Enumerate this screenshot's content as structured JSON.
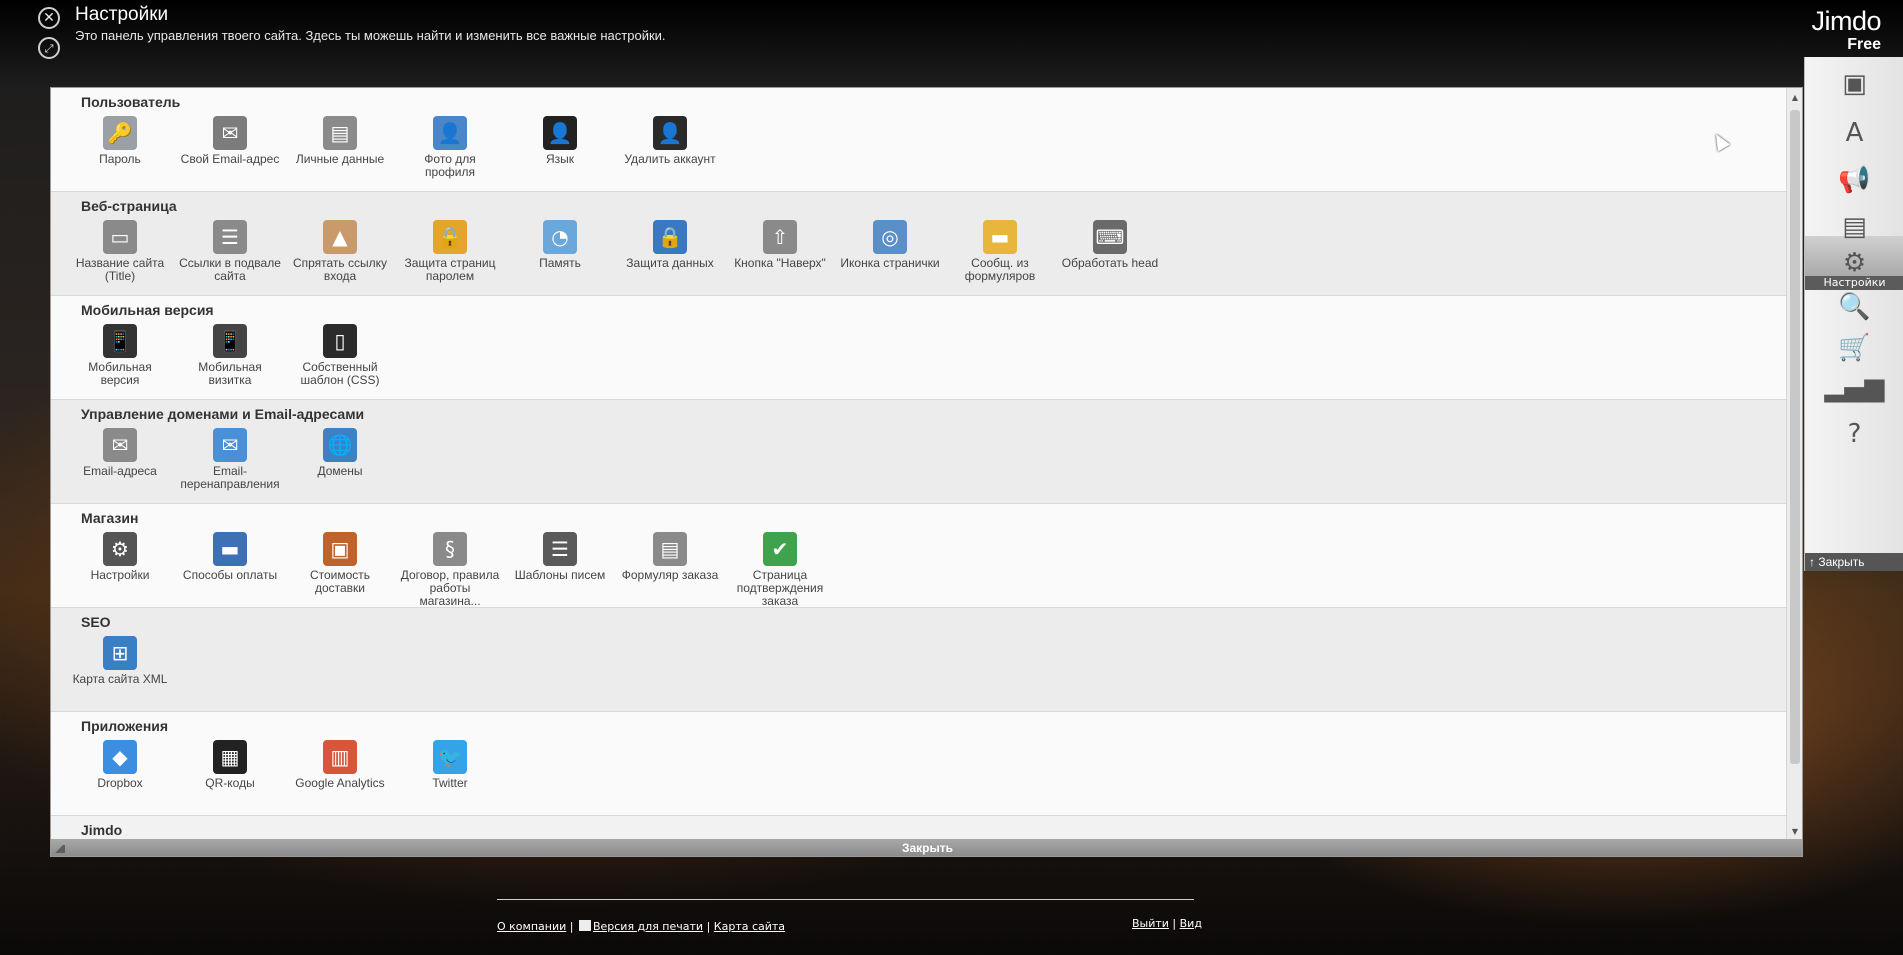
{
  "header": {
    "title": "Настройки",
    "description": "Это панель управления твоего сайта. Здесь ты можешь найти и изменить все важные настройки.",
    "brand_logo": "Jimdo",
    "brand_plan": "Free"
  },
  "sections": [
    {
      "title": "Пользователь",
      "items": [
        {
          "label": "Пароль",
          "icon": "key-icon",
          "glyph": "🔑",
          "color": "#9aa0a6"
        },
        {
          "label": "Свой Email-адрес",
          "icon": "envelope-icon",
          "glyph": "✉",
          "color": "#7c7c7c"
        },
        {
          "label": "Личные данные",
          "icon": "id-card-icon",
          "glyph": "▤",
          "color": "#8b8b8b"
        },
        {
          "label": "Фото для профиля",
          "icon": "profile-photo-icon",
          "glyph": "👤",
          "color": "#4a86c8"
        },
        {
          "label": "Язык",
          "icon": "user-language-icon",
          "glyph": "👤",
          "color": "#222222"
        },
        {
          "label": "Удалить аккаунт",
          "icon": "user-delete-icon",
          "glyph": "👤",
          "color": "#2a2a2a"
        }
      ]
    },
    {
      "title": "Веб-страница",
      "items": [
        {
          "label": "Название сайта (Title)",
          "icon": "site-title-icon",
          "glyph": "▭",
          "color": "#8a8a8a"
        },
        {
          "label": "Ссылки в подвале сайта",
          "icon": "footer-links-icon",
          "glyph": "☰",
          "color": "#8a8a8a"
        },
        {
          "label": "Спрятать ссылку входа",
          "icon": "hide-login-icon",
          "glyph": "▲",
          "color": "#c99b6c"
        },
        {
          "label": "Защита страниц паролем",
          "icon": "padlock-icon",
          "glyph": "🔒",
          "color": "#e3a52c"
        },
        {
          "label": "Память",
          "icon": "storage-pie-icon",
          "glyph": "◔",
          "color": "#6aa7da"
        },
        {
          "label": "Защита данных",
          "icon": "data-lock-icon",
          "glyph": "🔒",
          "color": "#3a78c4"
        },
        {
          "label": "Кнопка \"Наверх\"",
          "icon": "back-to-top-icon",
          "glyph": "⇧",
          "color": "#8a8a8a"
        },
        {
          "label": "Иконка странички",
          "icon": "favicon-icon",
          "glyph": "◎",
          "color": "#5a8fc7"
        },
        {
          "label": "Сообщ. из формуляров",
          "icon": "form-folder-icon",
          "glyph": "▬",
          "color": "#e8b63c"
        },
        {
          "label": "Обработать head",
          "icon": "head-code-icon",
          "glyph": "⌨",
          "color": "#6a6a6a"
        }
      ]
    },
    {
      "title": "Мобильная версия",
      "items": [
        {
          "label": "Мобильная версия",
          "icon": "mobile-phone-icon",
          "glyph": "📱",
          "color": "#333333"
        },
        {
          "label": "Мобильная визитка",
          "icon": "mobile-card-icon",
          "glyph": "📱",
          "color": "#444444"
        },
        {
          "label": "Собственный шаблон (CSS)",
          "icon": "mobile-css-icon",
          "glyph": "▯",
          "color": "#2b2b2b"
        }
      ]
    },
    {
      "title": "Управление доменами и Email-адресами",
      "items": [
        {
          "label": "Email-адреса",
          "icon": "email-settings-icon",
          "glyph": "✉",
          "color": "#8a8a8a"
        },
        {
          "label": "Email-перенаправления",
          "icon": "email-forward-icon",
          "glyph": "✉",
          "color": "#4a90d9"
        },
        {
          "label": "Домены",
          "icon": "globe-gear-icon",
          "glyph": "🌐",
          "color": "#3f7fc4"
        }
      ]
    },
    {
      "title": "Магазин",
      "items": [
        {
          "label": "Настройки",
          "icon": "shop-settings-icon",
          "glyph": "⚙",
          "color": "#555555"
        },
        {
          "label": "Способы оплаты",
          "icon": "credit-card-icon",
          "glyph": "▬",
          "color": "#3f6fb5"
        },
        {
          "label": "Стоимость доставки",
          "icon": "shipping-box-icon",
          "glyph": "▣",
          "color": "#c0622b"
        },
        {
          "label": "Договор, правила работы магазина...",
          "icon": "terms-document-icon",
          "glyph": "§",
          "color": "#8a8a8a"
        },
        {
          "label": "Шаблоны писем",
          "icon": "email-templates-icon",
          "glyph": "☰",
          "color": "#5a5a5a"
        },
        {
          "label": "Формуляр заказа",
          "icon": "order-form-icon",
          "glyph": "▤",
          "color": "#8a8a8a"
        },
        {
          "label": "Страница подтверждения заказа",
          "icon": "order-confirm-icon",
          "glyph": "✔",
          "color": "#3fa34d"
        }
      ]
    },
    {
      "title": "SEO",
      "items": [
        {
          "label": "Карта сайта XML",
          "icon": "sitemap-icon",
          "glyph": "⊞",
          "color": "#3a7fc4"
        }
      ]
    },
    {
      "title": "Приложения",
      "items": [
        {
          "label": "Dropbox",
          "icon": "dropbox-icon",
          "glyph": "◆",
          "color": "#3c8fe0"
        },
        {
          "label": "QR-коды",
          "icon": "qr-code-icon",
          "glyph": "▦",
          "color": "#222222"
        },
        {
          "label": "Google Analytics",
          "icon": "analytics-icon",
          "glyph": "▥",
          "color": "#d8543b"
        },
        {
          "label": "Twitter",
          "icon": "twitter-bird-icon",
          "glyph": "🐦",
          "color": "#35a3e8"
        }
      ]
    },
    {
      "title": "Jimdo",
      "items": []
    }
  ],
  "panel_footer_close": "Закрыть",
  "sidebar": {
    "items": [
      {
        "name": "layout-icon",
        "glyph": "▣",
        "label": ""
      },
      {
        "name": "style-icon",
        "glyph": "A",
        "label": ""
      },
      {
        "name": "megaphone-icon",
        "glyph": "📢",
        "label": ""
      },
      {
        "name": "box-icon",
        "glyph": "▤",
        "label": ""
      },
      {
        "name": "settings-gear-icon",
        "glyph": "⚙",
        "label": "Настройки",
        "active": true
      },
      {
        "name": "seo-magnifier-icon",
        "glyph": "🔍",
        "label": ""
      },
      {
        "name": "shopping-cart-icon",
        "glyph": "🛒",
        "label": ""
      },
      {
        "name": "statistics-icon",
        "glyph": "▂▄▆",
        "label": ""
      },
      {
        "name": "help-icon",
        "glyph": "?",
        "label": ""
      }
    ],
    "close_label": "↑ Закрыть"
  },
  "site_footer": {
    "about": "О компании",
    "print": "Версия для печати",
    "sitemap": "Карта сайта",
    "logout": "Выйти",
    "view": "Вид"
  }
}
